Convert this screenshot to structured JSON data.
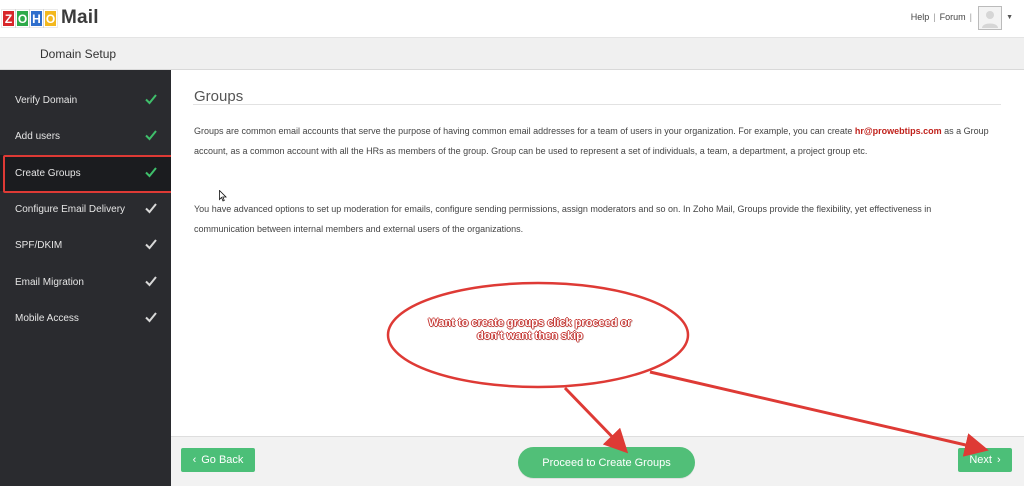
{
  "header": {
    "logo_letters": [
      "Z",
      "O",
      "H",
      "O"
    ],
    "logo_colors": [
      "#d8262a",
      "#2eaa4a",
      "#2f6fcd",
      "#f3b81e"
    ],
    "logo_word": "Mail",
    "help_link": "Help",
    "forum_link": "Forum",
    "separator": "|"
  },
  "subheader": {
    "title": "Domain Setup"
  },
  "sidebar": {
    "items": [
      {
        "label": "Verify Domain",
        "check": "✓"
      },
      {
        "label": "Add users",
        "check": "✓"
      },
      {
        "label": "Create Groups",
        "check": "✓"
      },
      {
        "label": "Configure Email Delivery",
        "check": "✓"
      },
      {
        "label": "SPF/DKIM",
        "check": "✓"
      },
      {
        "label": "Email Migration",
        "check": "✓"
      },
      {
        "label": "Mobile Access",
        "check": "✓"
      }
    ],
    "active_index": 2,
    "done_check_color": "#3fbf6b",
    "pending_check_color": "#d8d8d8"
  },
  "main": {
    "heading": "Groups",
    "para1_before": "Groups are common email accounts that serve the purpose of having common email addresses for a team of users in your organization. For example, you can create ",
    "para1_email": "hr@prowebtips.com",
    "para1_after": " as a Group account, as a common account with all the HRs as members of the group. Group can be used to represent a set of individuals, a team, a department, a project group etc.",
    "para2": "You have advanced options to set up moderation for emails, configure sending permissions, assign moderators and so on. In Zoho Mail, Groups provide the flexibility, yet effectiveness in communication between internal members and external users of the organizations."
  },
  "footer": {
    "back_label": "Go Back",
    "back_icon": "‹",
    "proceed_label": "Proceed to Create Groups",
    "next_label": "Next",
    "next_icon": "›"
  },
  "annotation": {
    "callout_line1": "Want to create groups click proceed or",
    "callout_line2": "don't want then skip",
    "annotation_color": "#de3a35"
  }
}
